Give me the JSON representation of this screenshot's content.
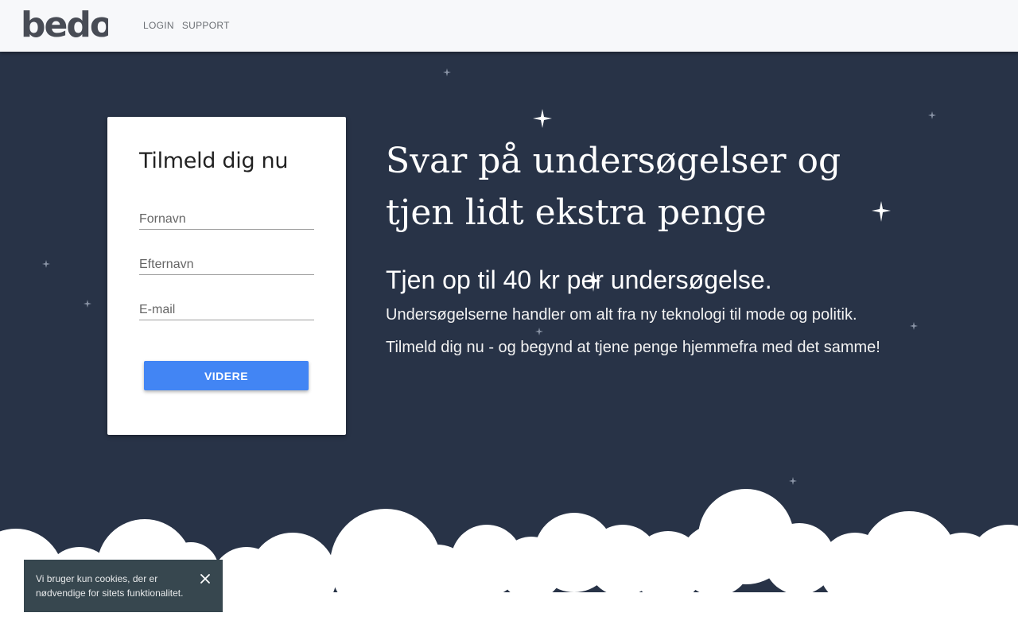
{
  "header": {
    "logo_text": "bedo",
    "nav": [
      {
        "label": "LOGIN"
      },
      {
        "label": "SUPPORT"
      }
    ]
  },
  "signup_card": {
    "title": "Tilmeld dig nu",
    "fields": {
      "first_name_placeholder": "Fornavn",
      "last_name_placeholder": "Efternavn",
      "email_placeholder": "E-mail"
    },
    "submit_label": "VIDERE"
  },
  "hero": {
    "headline": "Svar på undersøgelser og tjen lidt ekstra penge",
    "subhead": "Tjen op til 40 kr per undersøgelse.",
    "paragraph_1": "Undersøgelserne handler om alt fra ny teknologi til mode og politik.",
    "paragraph_2": "Tilmeld dig nu - og begynd at tjene penge hjemmefra med det samme!"
  },
  "cookie_notice": {
    "text": "Vi bruger kun cookies, der er nødvendige for sitets funktionalitet.",
    "close_icon": "close-icon"
  },
  "colors": {
    "hero_background": "#283347",
    "header_background": "#f7f8fa",
    "button": "#4285f4",
    "cookie_background": "#37474f",
    "logo": "#484c55"
  }
}
